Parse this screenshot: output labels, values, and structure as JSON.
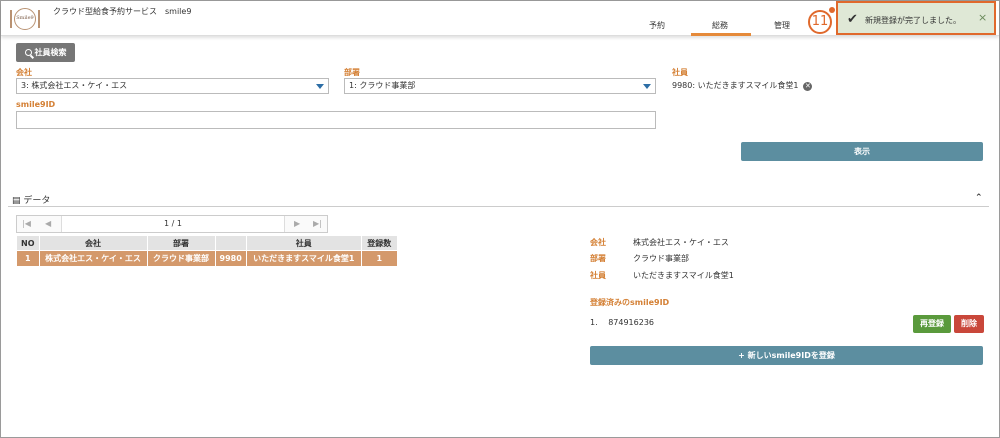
{
  "header": {
    "logo_text": "Smile9",
    "title": "クラウド型給食予約サービス　smile9",
    "tabs": [
      {
        "label": "予約"
      },
      {
        "label": "総務"
      },
      {
        "label": "管理"
      }
    ],
    "active_tab": "総務"
  },
  "toast": {
    "step_badge": "11",
    "message": "新規登録が完了しました。",
    "close": "×"
  },
  "search": {
    "employee_search_label": "社員検索",
    "company_label": "会社",
    "company_value": "3: 株式会社エス・ケイ・エス",
    "department_label": "部署",
    "department_value": "1: クラウド事業部",
    "employee_label": "社員",
    "employee_value": "9980:  いただきますスマイル食堂1",
    "smile9id_label": "smile9ID",
    "smile9id_value": "",
    "show_button": "表示"
  },
  "data_section": {
    "title": "データ",
    "pager": {
      "page": "1 / 1"
    },
    "table": {
      "columns": [
        "NO",
        "会社",
        "部署",
        "",
        "社員",
        "登録数"
      ],
      "rows": [
        [
          "1",
          "株式会社エス・ケイ・エス",
          "クラウド事業部",
          "9980",
          "いただきますスマイル食堂1",
          "1"
        ]
      ]
    }
  },
  "detail": {
    "company_label": "会社",
    "company_value": "株式会社エス・ケイ・エス",
    "department_label": "部署",
    "department_value": "クラウド事業部",
    "employee_label": "社員",
    "employee_value": "いただきますスマイル食堂1",
    "registered_label": "登録済みのsmile9ID",
    "registered_items": [
      {
        "no": "1.",
        "id": "874916236"
      }
    ],
    "reregister_button": "再登録",
    "delete_button": "削除",
    "new_button": "+ 新しいsmile9IDを登録"
  },
  "colors": {
    "accent": "#e58a3a",
    "label": "#d48035",
    "primary_button": "#5c8ea0",
    "success": "#5a9a3c",
    "danger": "#c9473a",
    "selected_row": "#d4996b"
  }
}
